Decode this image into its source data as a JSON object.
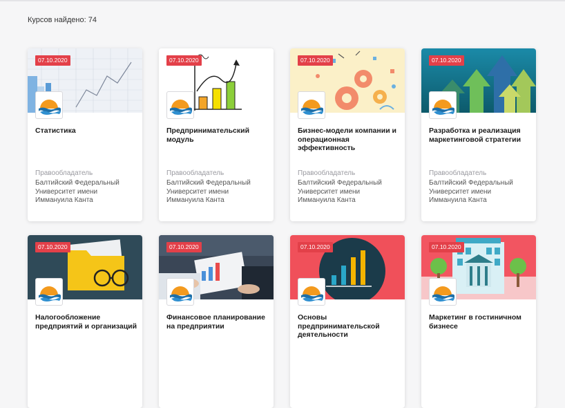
{
  "courses_found": "Курсов найдено: 74",
  "owner_label": "Правообладатель",
  "courses": [
    {
      "date": "07.10.2020",
      "title": "Статистика",
      "owner": "Балтийский Федеральный Университет имени Иммануила Канта"
    },
    {
      "date": "07.10.2020",
      "title": "Предпринимательский модуль",
      "owner": "Балтийский Федеральный Университет имени Иммануила Канта"
    },
    {
      "date": "07.10.2020",
      "title": "Бизнес-модели компании и операционная эффективность",
      "owner": "Балтийский Федеральный Университет имени Иммануила Канта"
    },
    {
      "date": "07.10.2020",
      "title": "Разработка и реализация маркетинговой стратегии",
      "owner": "Балтийский Федеральный Университет имени Иммануила Канта"
    },
    {
      "date": "07.10.2020",
      "title": "Налогообложение предприятий и организаций"
    },
    {
      "date": "07.10.2020",
      "title": "Финансовое планирование на предприятии"
    },
    {
      "date": "07.10.2020",
      "title": "Основы предпринимательской деятельности"
    },
    {
      "date": "07.10.2020",
      "title": "Маркетинг в гостиничном бизнесе"
    }
  ],
  "colors": {
    "date_badge": "#e34049",
    "logo_orange": "#f39a1e",
    "logo_blue": "#1e6fa8"
  }
}
